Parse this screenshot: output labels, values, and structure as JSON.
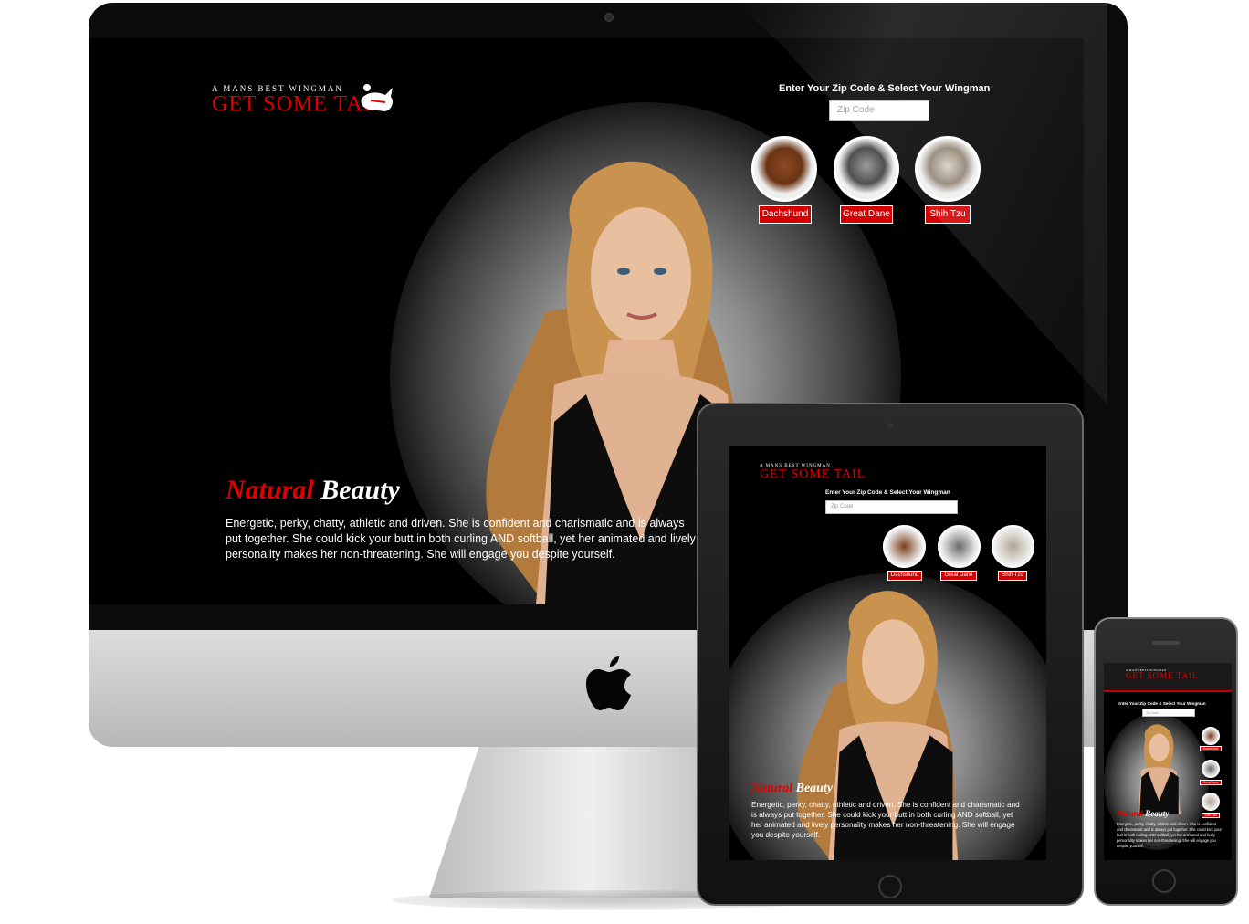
{
  "brand": {
    "tagline": "A MANS BEST WINGMAN",
    "name": "GET SOME TAIL"
  },
  "wingman": {
    "title": "Enter Your Zip Code & Select Your Wingman",
    "zip_placeholder": "Zip Code",
    "dogs": [
      {
        "label": "Dachshund",
        "icon": "dachshund-icon"
      },
      {
        "label": "Great Dane",
        "icon": "great-dane-icon"
      },
      {
        "label": "Shih Tzu",
        "icon": "shih-tzu-icon"
      }
    ]
  },
  "feature": {
    "headline_red": "Natural",
    "headline_white": "Beauty",
    "description": "Energetic, perky, chatty, athletic and driven. She is confident and charismatic and is always put together. She could kick your butt in both curling AND softball, yet her animated and lively personality makes her non-threatening. She will engage you despite yourself."
  },
  "devices": [
    "imac",
    "ipad",
    "iphone"
  ],
  "colors": {
    "brand_red": "#e00000",
    "button_red": "#d40000",
    "screen_bg": "#000000"
  }
}
